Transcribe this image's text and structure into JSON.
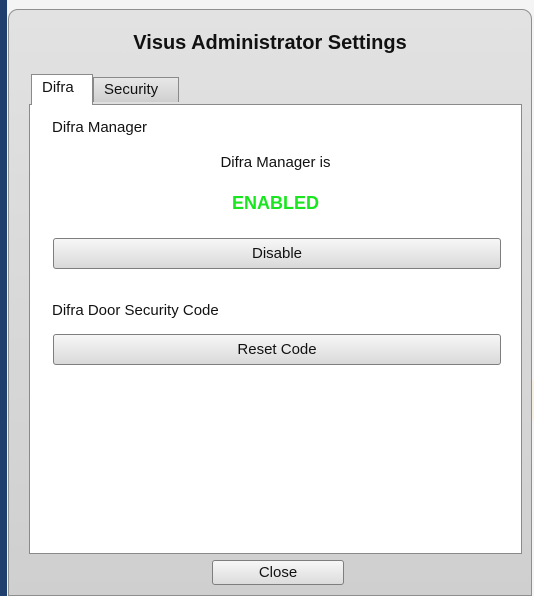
{
  "dialog": {
    "title": "Visus Administrator Settings"
  },
  "tabs": [
    {
      "label": "Difra",
      "active": true
    },
    {
      "label": "Security",
      "active": false
    }
  ],
  "difra_manager": {
    "section_label": "Difra Manager",
    "status_text": "Difra Manager is",
    "status_value": "ENABLED",
    "status_color": "#19e61f",
    "toggle_button_label": "Disable"
  },
  "door_security": {
    "section_label": "Difra Door Security Code",
    "reset_button_label": "Reset Code"
  },
  "footer": {
    "close_label": "Close"
  }
}
